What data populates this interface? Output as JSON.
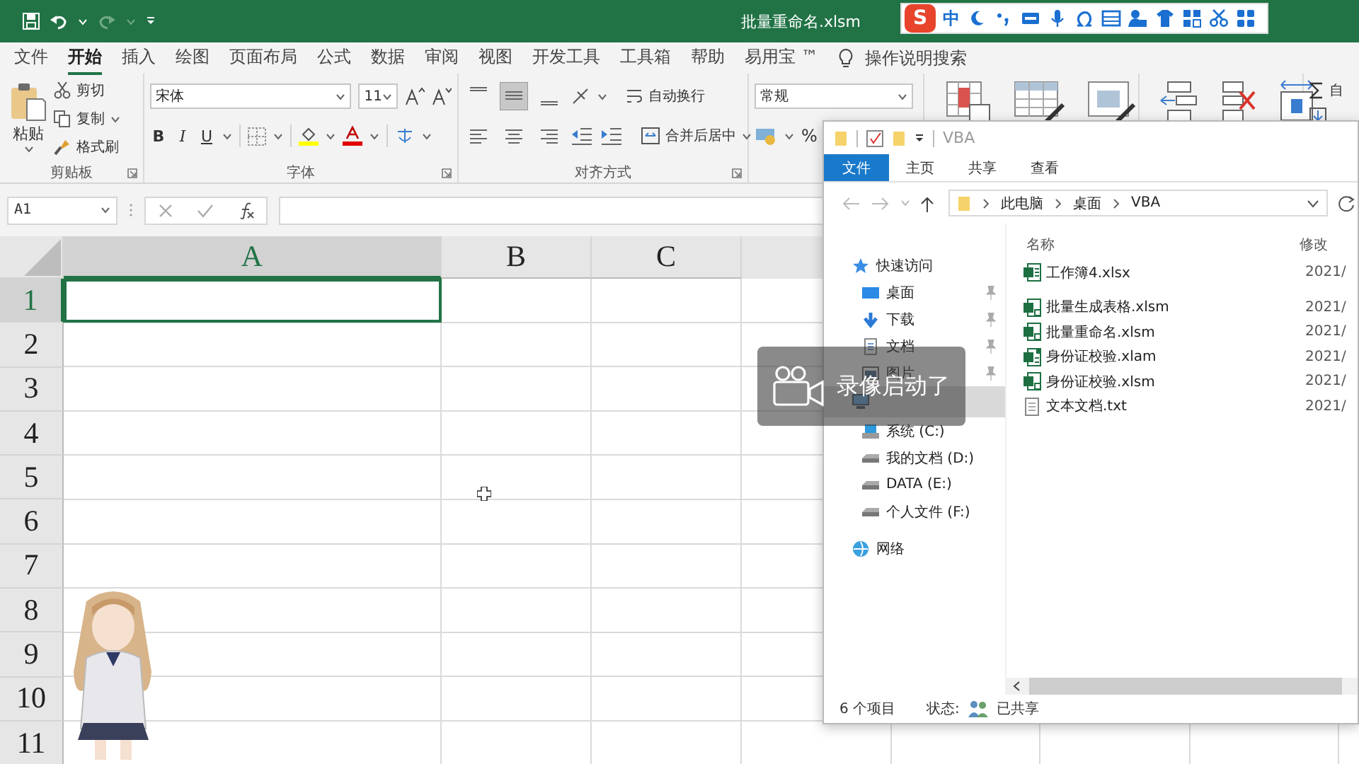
{
  "excel": {
    "title": "批量重命名.xlsm",
    "menu_tabs": [
      {
        "label": "文件",
        "selected": false
      },
      {
        "label": "开始",
        "selected": true
      },
      {
        "label": "插入",
        "selected": false
      },
      {
        "label": "绘图",
        "selected": false
      },
      {
        "label": "页面布局",
        "selected": false
      },
      {
        "label": "公式",
        "selected": false
      },
      {
        "label": "数据",
        "selected": false
      },
      {
        "label": "审阅",
        "selected": false
      },
      {
        "label": "视图",
        "selected": false
      },
      {
        "label": "开发工具",
        "selected": false
      },
      {
        "label": "工具箱",
        "selected": false
      },
      {
        "label": "帮助",
        "selected": false
      },
      {
        "label": "易用宝 ™",
        "selected": false
      }
    ],
    "tell_me": "操作说明搜索",
    "clipboard": {
      "paste": "粘贴",
      "cut": "剪切",
      "copy": "复制",
      "format_painter": "格式刷",
      "group": "剪贴板"
    },
    "font": {
      "name": "宋体",
      "size": "11",
      "bold": "B",
      "italic": "I",
      "underline": "U",
      "group": "字体"
    },
    "alignment": {
      "wrap": "自动换行",
      "merge": "合并后居中",
      "group": "对齐方式"
    },
    "number": {
      "format": "常规",
      "percent": "%"
    },
    "editing": {
      "autosum": "自"
    },
    "name_box": "A1",
    "columns": [
      {
        "label": "A",
        "selected": true
      },
      {
        "label": "B",
        "selected": false
      },
      {
        "label": "C",
        "selected": false
      }
    ],
    "rows": [
      {
        "label": "1",
        "selected": true
      },
      {
        "label": "2",
        "selected": false
      },
      {
        "label": "3",
        "selected": false
      },
      {
        "label": "4",
        "selected": false
      },
      {
        "label": "5",
        "selected": false
      },
      {
        "label": "6",
        "selected": false
      },
      {
        "label": "7",
        "selected": false
      },
      {
        "label": "8",
        "selected": false
      },
      {
        "label": "9",
        "selected": false
      },
      {
        "label": "10",
        "selected": false
      },
      {
        "label": "11",
        "selected": false
      }
    ]
  },
  "ime_bar": {
    "logo": "S",
    "mode": "中"
  },
  "explorer": {
    "title": "VBA",
    "tabs": [
      {
        "label": "文件",
        "selected": true
      },
      {
        "label": "主页",
        "selected": false
      },
      {
        "label": "共享",
        "selected": false
      },
      {
        "label": "查看",
        "selected": false
      }
    ],
    "path": [
      "此电脑",
      "桌面",
      "VBA"
    ],
    "nav": [
      {
        "label": "快速访问",
        "kind": "quick",
        "selected": false,
        "children": [
          {
            "label": "桌面",
            "kind": "desktop",
            "pinned": true,
            "selected": false
          },
          {
            "label": "下载",
            "kind": "download",
            "pinned": true,
            "selected": false
          },
          {
            "label": "文档",
            "kind": "document",
            "pinned": true,
            "selected": false
          },
          {
            "label": "图片",
            "kind": "picture",
            "pinned": true,
            "selected": false
          }
        ]
      },
      {
        "kind": "pc",
        "selected": true,
        "children": [
          {
            "label": "系统 (C:)",
            "kind": "sysdrive",
            "selected": false
          },
          {
            "label": "我的文档 (D:)",
            "kind": "drive",
            "selected": false
          },
          {
            "label": "DATA (E:)",
            "kind": "drive",
            "selected": false
          },
          {
            "label": "个人文件 (F:)",
            "kind": "drive",
            "selected": false
          }
        ]
      },
      {
        "label": "网络",
        "kind": "network",
        "selected": false
      }
    ],
    "columns": [
      "名称",
      "修改"
    ],
    "files": [
      {
        "name": "工作簿4.xlsx",
        "kind": "xlsx",
        "date": "2021/"
      },
      {
        "name": "批量生成表格.xlsm",
        "kind": "xlsm",
        "date": "2021/"
      },
      {
        "name": "批量重命名.xlsm",
        "kind": "xlsm",
        "date": "2021/"
      },
      {
        "name": "身份证校验.xlam",
        "kind": "xlam",
        "date": "2021/"
      },
      {
        "name": "身份证校验.xlsm",
        "kind": "xlsm",
        "date": "2021/"
      },
      {
        "name": "文本文档.txt",
        "kind": "txt",
        "date": "2021/"
      }
    ],
    "item_count": "6 个项目",
    "status_label": "状态:",
    "status": "已共享"
  },
  "toast": {
    "text": "录像启动了"
  }
}
